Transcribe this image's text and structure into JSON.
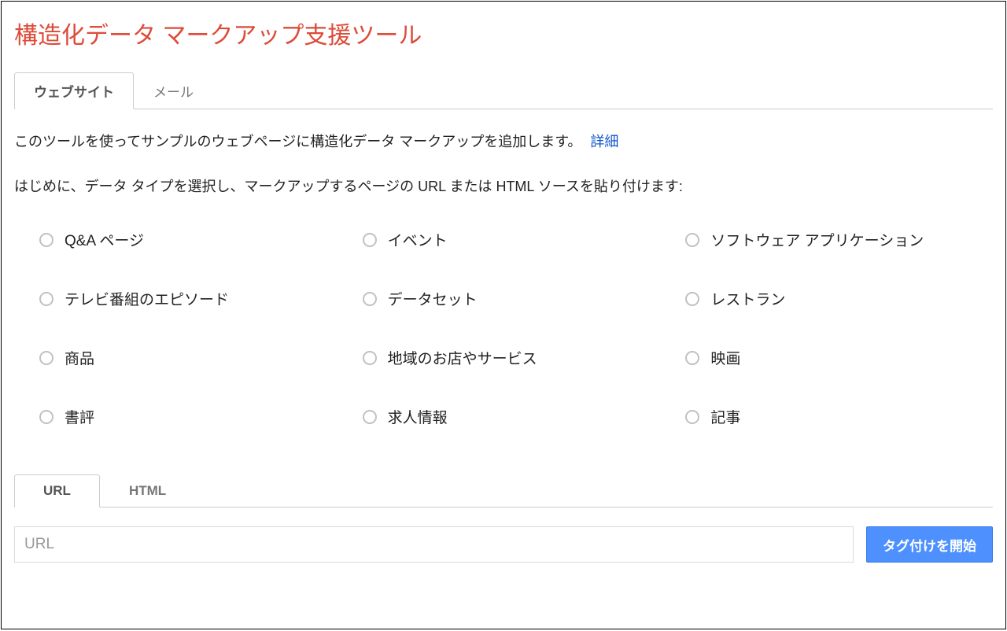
{
  "title": "構造化データ マークアップ支援ツール",
  "tabs": [
    {
      "label": "ウェブサイト",
      "active": true
    },
    {
      "label": "メール",
      "active": false
    }
  ],
  "intro_text": "このツールを使ってサンプルのウェブページに構造化データ マークアップを追加します。",
  "details_link": "詳細",
  "instruction_text": "はじめに、データ タイプを選択し、マークアップするページの URL または HTML ソースを貼り付けます:",
  "data_types": [
    "Q&A ページ",
    "イベント",
    "ソフトウェア アプリケーション",
    "テレビ番組のエピソード",
    "データセット",
    "レストラン",
    "商品",
    "地域のお店やサービス",
    "映画",
    "書評",
    "求人情報",
    "記事"
  ],
  "input_tabs": [
    {
      "label": "URL",
      "active": true
    },
    {
      "label": "HTML",
      "active": false
    }
  ],
  "url_input": {
    "placeholder": "URL",
    "value": ""
  },
  "start_button_label": "タグ付けを開始"
}
